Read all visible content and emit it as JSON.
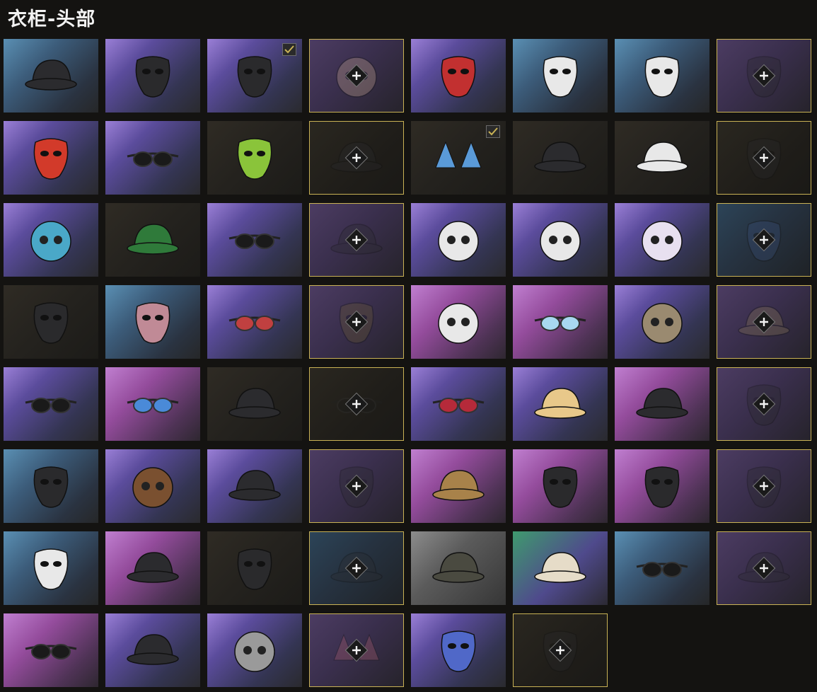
{
  "title": "衣柜-头部",
  "colors": {
    "gold": "#c9b255",
    "text": "#f2f2f2",
    "background": "#141311"
  },
  "slots": [
    {
      "item": "headset-cap",
      "bg": "blue",
      "state": "owned",
      "equipped": false
    },
    {
      "item": "face-scarf",
      "bg": "purple",
      "state": "owned",
      "equipped": false
    },
    {
      "item": "skull-mask",
      "bg": "purple",
      "state": "owned",
      "equipped": true
    },
    {
      "item": "poodle-head",
      "bg": "dimpurple",
      "state": "unowned",
      "equipped": false
    },
    {
      "item": "red-skull-mask",
      "bg": "purple",
      "state": "owned",
      "equipped": false
    },
    {
      "item": "clown-mask",
      "bg": "blue",
      "state": "owned",
      "equipped": false
    },
    {
      "item": "joker-mask",
      "bg": "blue",
      "state": "owned",
      "equipped": false
    },
    {
      "item": "tribal-mask",
      "bg": "dimpurple",
      "state": "unowned",
      "equipped": false
    },
    {
      "item": "oni-mask",
      "bg": "purple",
      "state": "owned",
      "equipped": false
    },
    {
      "item": "goggles-mask",
      "bg": "purple",
      "state": "owned",
      "equipped": false
    },
    {
      "item": "alien-mask",
      "bg": "dark",
      "state": "owned",
      "equipped": false
    },
    {
      "item": "dark-cap",
      "bg": "empty",
      "state": "unowned",
      "equipped": false
    },
    {
      "item": "cat-ears",
      "bg": "dark",
      "state": "owned",
      "equipped": true
    },
    {
      "item": "chicken-hat",
      "bg": "dark",
      "state": "owned",
      "equipped": false
    },
    {
      "item": "white-beanie",
      "bg": "dark",
      "state": "owned",
      "equipped": false
    },
    {
      "item": "bandana",
      "bg": "empty",
      "state": "unowned",
      "equipped": false
    },
    {
      "item": "dino-hood",
      "bg": "purple",
      "state": "owned",
      "equipped": false
    },
    {
      "item": "elf-hat",
      "bg": "dark",
      "state": "owned",
      "equipped": false
    },
    {
      "item": "visor-glasses",
      "bg": "purple",
      "state": "owned",
      "equipped": false
    },
    {
      "item": "patterned-bucket-hat",
      "bg": "dimpurple",
      "state": "unowned",
      "equipped": false
    },
    {
      "item": "hooded-jacket",
      "bg": "purple",
      "state": "owned",
      "equipped": false
    },
    {
      "item": "skull-hood-black",
      "bg": "purple",
      "state": "owned",
      "equipped": false
    },
    {
      "item": "skull-hood-purple",
      "bg": "purple",
      "state": "owned",
      "equipped": false
    },
    {
      "item": "blue-mask",
      "bg": "dimblue",
      "state": "unowned",
      "equipped": false
    },
    {
      "item": "face-wrap",
      "bg": "dark",
      "state": "owned",
      "equipped": false
    },
    {
      "item": "pink-scarf",
      "bg": "blue",
      "state": "owned",
      "equipped": false
    },
    {
      "item": "round-sunglasses",
      "bg": "purple",
      "state": "owned",
      "equipped": false
    },
    {
      "item": "gold-mask",
      "bg": "dimpurple",
      "state": "unowned",
      "equipped": false
    },
    {
      "item": "headphones",
      "bg": "pink",
      "state": "owned",
      "equipped": false
    },
    {
      "item": "sport-shades",
      "bg": "pink",
      "state": "owned",
      "equipped": false
    },
    {
      "item": "trex-head",
      "bg": "purple",
      "state": "owned",
      "equipped": false
    },
    {
      "item": "safari-hat",
      "bg": "dimpurple",
      "state": "unowned",
      "equipped": false
    },
    {
      "item": "square-glasses",
      "bg": "purple",
      "state": "owned",
      "equipped": false
    },
    {
      "item": "star-glasses",
      "bg": "pink",
      "state": "owned",
      "equipped": false
    },
    {
      "item": "shark-bucket-hat",
      "bg": "dark",
      "state": "owned",
      "equipped": false
    },
    {
      "item": "dark-sunglasses",
      "bg": "empty",
      "state": "unowned",
      "equipped": false
    },
    {
      "item": "cat-eye-glasses",
      "bg": "purple",
      "state": "owned",
      "equipped": false
    },
    {
      "item": "straw-sun-hat",
      "bg": "purple",
      "state": "owned",
      "equipped": false
    },
    {
      "item": "black-cat-hat",
      "bg": "pink",
      "state": "owned",
      "equipped": false
    },
    {
      "item": "snake-eye-mask",
      "bg": "dimpurple",
      "state": "unowned",
      "equipped": false
    },
    {
      "item": "black-face-mask",
      "bg": "blue",
      "state": "owned",
      "equipped": false
    },
    {
      "item": "bear-head",
      "bg": "purple",
      "state": "owned",
      "equipped": false
    },
    {
      "item": "cap-with-headset",
      "bg": "purple",
      "state": "owned",
      "equipped": false
    },
    {
      "item": "scarecrow-mask",
      "bg": "dimpurple",
      "state": "unowned",
      "equipped": false
    },
    {
      "item": "leopard-bucket-hat",
      "bg": "pink",
      "state": "owned",
      "equipped": false
    },
    {
      "item": "fox-mask",
      "bg": "pink",
      "state": "owned",
      "equipped": false
    },
    {
      "item": "snake-bandana",
      "bg": "pink",
      "state": "owned",
      "equipped": false
    },
    {
      "item": "mask-ears",
      "bg": "dimpurple",
      "state": "unowned",
      "equipped": false
    },
    {
      "item": "white-face-mask",
      "bg": "blue",
      "state": "owned",
      "equipped": false
    },
    {
      "item": "j-cap",
      "bg": "pink",
      "state": "owned",
      "equipped": false
    },
    {
      "item": "tactical-mask",
      "bg": "dark",
      "state": "owned",
      "equipped": false
    },
    {
      "item": "black-helmet",
      "bg": "dimblue",
      "state": "unowned",
      "equipped": false
    },
    {
      "item": "camo-cap",
      "bg": "grey",
      "state": "owned",
      "equipped": false
    },
    {
      "item": "pith-helmet",
      "bg": "green",
      "state": "owned",
      "equipped": false
    },
    {
      "item": "wrap-sunglasses",
      "bg": "blue",
      "state": "owned",
      "equipped": false
    },
    {
      "item": "knight-helmet",
      "bg": "dimpurple",
      "state": "unowned",
      "equipped": false
    },
    {
      "item": "eye-patch-goggles",
      "bg": "pink",
      "state": "owned",
      "equipped": false
    },
    {
      "item": "canvas-bucket-hat",
      "bg": "purple",
      "state": "owned",
      "equipped": false
    },
    {
      "item": "teddy-bear-head",
      "bg": "purple",
      "state": "owned",
      "equipped": false
    },
    {
      "item": "pink-bow",
      "bg": "dimpurple",
      "state": "unowned",
      "equipped": false
    },
    {
      "item": "cute-face-mask",
      "bg": "purple",
      "state": "owned",
      "equipped": false
    },
    {
      "item": "black-cloth-mask",
      "bg": "empty",
      "state": "unowned",
      "equipped": false
    }
  ]
}
